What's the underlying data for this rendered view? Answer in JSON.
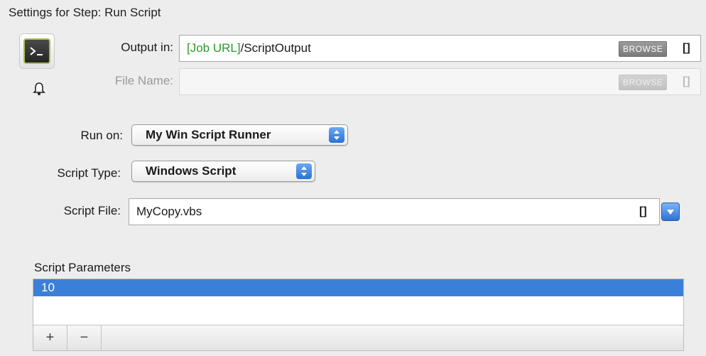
{
  "title": "Settings for Step: Run Script",
  "icons": {
    "step": "terminal-icon",
    "bell": "bell-icon",
    "popup_arrows": "up-down-arrows-icon",
    "combo": "chevron-down-icon"
  },
  "output": {
    "label": "Output in:",
    "variable": "[Job URL]",
    "path": "/ScriptOutput",
    "browse_label": "BROWSE",
    "vars_label": "[]"
  },
  "file_name": {
    "label": "File Name:",
    "value": "",
    "browse_label": "BROWSE",
    "vars_label": "[]"
  },
  "run_on": {
    "label": "Run on:",
    "value": "My Win Script Runner"
  },
  "script_type": {
    "label": "Script Type:",
    "value": "Windows Script"
  },
  "script_file": {
    "label": "Script File:",
    "value": "MyCopy.vbs",
    "vars_label": "[]"
  },
  "params": {
    "label": "Script Parameters",
    "rows": [
      "10"
    ],
    "add_label": "+",
    "remove_label": "−"
  },
  "colors": {
    "variable": "#2c9a2c",
    "selection": "#3c7fd8",
    "accent": "#2f72d6"
  }
}
